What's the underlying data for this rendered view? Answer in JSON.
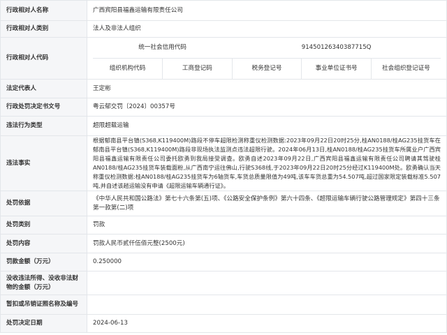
{
  "rows": {
    "name": {
      "label": "行政相对人名称",
      "value": "广西宾阳县福鑫运输有限责任公司"
    },
    "category": {
      "label": "行政相对人类别",
      "value": "法人及非法人组织"
    },
    "code": {
      "label": "行政相对人代码",
      "credit_code_label": "统一社会信用代码",
      "credit_code_value": "91450126340387715Q",
      "sub_labels": [
        "组织机构代码",
        "工商登记码",
        "税务登记号",
        "事业单位证书号",
        "社会组织登记证号"
      ]
    },
    "legal_rep": {
      "label": "法定代表人",
      "value": "王定彬"
    },
    "doc_no": {
      "label": "行政处罚决定书文号",
      "value": "粤云郁交罚〔2024〕00357号"
    },
    "violation_type": {
      "label": "违法行为类型",
      "value": "超限超载运输"
    },
    "facts": {
      "label": "违法事实",
      "value": "根据郁南县平台镇(S368,K119400M)路段不停车超限检测称重仪检测数据:2023年09月22日20时25分,桂AN0188/桂AG235挂货车在郁南县平台镇(S368,K119400M)路段非现场执法监测点违法超限行驶。2024年06月13日,桂AN0188/桂AG235挂货车所属业户广西宾阳县福鑫运输有限责任公司委托欧勇到我局接受调查。欧勇自述2023年09月22日,广西宾阳县福鑫运输有限责任公司聘请其驾驶桂AN0188/桂AG235挂货车装载面粉,从广西南宁运往佛山,行驶S368线,于2023年09月22日20时25分经过K119400M处。欧勇确认当天称重仪检测数据:桂AN0188/桂AG235挂货车为6轴货车,车货总质量限值为49吨,该车车货总重为54.507吨,超过国家限定装载标准5.507吨,并自述该趟运输没有申请《超限运输车辆通行证》。"
    },
    "basis": {
      "label": "处罚依据",
      "value": "《中华人民共和国公路法》第七十六条第(五)项、《公路安全保护条例》第六十四条、《超限运输车辆行驶公路管理规定》第四十三条第一款第(二)项"
    },
    "penalty_type": {
      "label": "处罚类别",
      "value": "罚款"
    },
    "penalty_content": {
      "label": "处罚内容",
      "value": "罚款人民币贰仟伍佰元整(2500元)"
    },
    "fine_amount": {
      "label": "罚款金额（万元）",
      "value": "0.250000"
    },
    "confiscated": {
      "label": "没收违法所得、没收非法财物的金额（万元）",
      "value": ""
    },
    "license": {
      "label": "暂扣或吊销证照名称及编号",
      "value": ""
    },
    "decision_date": {
      "label": "处罚决定日期",
      "value": "2024-06-13"
    }
  }
}
